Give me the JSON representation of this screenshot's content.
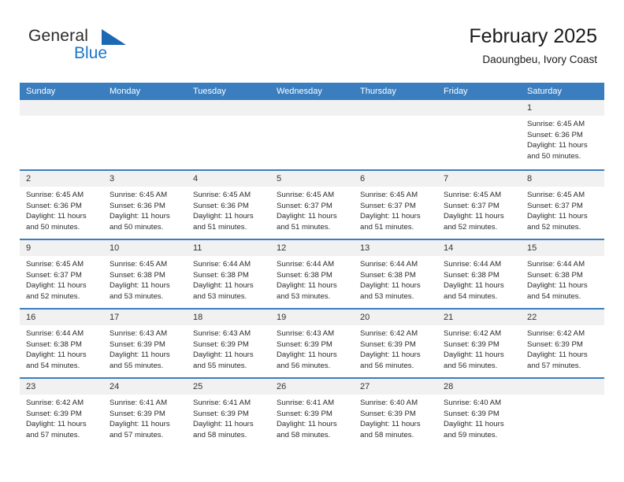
{
  "brand": {
    "name_top": "General",
    "name_bottom": "Blue",
    "accent_color": "#1c76c8",
    "triangle_color": "#1c69b3"
  },
  "header": {
    "title": "February 2025",
    "subtitle": "Daoungbeu, Ivory Coast"
  },
  "theme": {
    "header_blue": "#3a7ebf",
    "day_band_gray": "#f1f1f1",
    "text": "#2b2b2b"
  },
  "weekdays": [
    "Sunday",
    "Monday",
    "Tuesday",
    "Wednesday",
    "Thursday",
    "Friday",
    "Saturday"
  ],
  "weeks": [
    [
      {
        "day": "",
        "empty": true,
        "sunrise": "",
        "sunset": "",
        "daylight1": "",
        "daylight2": ""
      },
      {
        "day": "",
        "empty": true,
        "sunrise": "",
        "sunset": "",
        "daylight1": "",
        "daylight2": ""
      },
      {
        "day": "",
        "empty": true,
        "sunrise": "",
        "sunset": "",
        "daylight1": "",
        "daylight2": ""
      },
      {
        "day": "",
        "empty": true,
        "sunrise": "",
        "sunset": "",
        "daylight1": "",
        "daylight2": ""
      },
      {
        "day": "",
        "empty": true,
        "sunrise": "",
        "sunset": "",
        "daylight1": "",
        "daylight2": ""
      },
      {
        "day": "",
        "empty": true,
        "sunrise": "",
        "sunset": "",
        "daylight1": "",
        "daylight2": ""
      },
      {
        "day": "1",
        "empty": false,
        "sunrise": "Sunrise: 6:45 AM",
        "sunset": "Sunset: 6:36 PM",
        "daylight1": "Daylight: 11 hours",
        "daylight2": "and 50 minutes."
      }
    ],
    [
      {
        "day": "2",
        "empty": false,
        "sunrise": "Sunrise: 6:45 AM",
        "sunset": "Sunset: 6:36 PM",
        "daylight1": "Daylight: 11 hours",
        "daylight2": "and 50 minutes."
      },
      {
        "day": "3",
        "empty": false,
        "sunrise": "Sunrise: 6:45 AM",
        "sunset": "Sunset: 6:36 PM",
        "daylight1": "Daylight: 11 hours",
        "daylight2": "and 50 minutes."
      },
      {
        "day": "4",
        "empty": false,
        "sunrise": "Sunrise: 6:45 AM",
        "sunset": "Sunset: 6:36 PM",
        "daylight1": "Daylight: 11 hours",
        "daylight2": "and 51 minutes."
      },
      {
        "day": "5",
        "empty": false,
        "sunrise": "Sunrise: 6:45 AM",
        "sunset": "Sunset: 6:37 PM",
        "daylight1": "Daylight: 11 hours",
        "daylight2": "and 51 minutes."
      },
      {
        "day": "6",
        "empty": false,
        "sunrise": "Sunrise: 6:45 AM",
        "sunset": "Sunset: 6:37 PM",
        "daylight1": "Daylight: 11 hours",
        "daylight2": "and 51 minutes."
      },
      {
        "day": "7",
        "empty": false,
        "sunrise": "Sunrise: 6:45 AM",
        "sunset": "Sunset: 6:37 PM",
        "daylight1": "Daylight: 11 hours",
        "daylight2": "and 52 minutes."
      },
      {
        "day": "8",
        "empty": false,
        "sunrise": "Sunrise: 6:45 AM",
        "sunset": "Sunset: 6:37 PM",
        "daylight1": "Daylight: 11 hours",
        "daylight2": "and 52 minutes."
      }
    ],
    [
      {
        "day": "9",
        "empty": false,
        "sunrise": "Sunrise: 6:45 AM",
        "sunset": "Sunset: 6:37 PM",
        "daylight1": "Daylight: 11 hours",
        "daylight2": "and 52 minutes."
      },
      {
        "day": "10",
        "empty": false,
        "sunrise": "Sunrise: 6:45 AM",
        "sunset": "Sunset: 6:38 PM",
        "daylight1": "Daylight: 11 hours",
        "daylight2": "and 53 minutes."
      },
      {
        "day": "11",
        "empty": false,
        "sunrise": "Sunrise: 6:44 AM",
        "sunset": "Sunset: 6:38 PM",
        "daylight1": "Daylight: 11 hours",
        "daylight2": "and 53 minutes."
      },
      {
        "day": "12",
        "empty": false,
        "sunrise": "Sunrise: 6:44 AM",
        "sunset": "Sunset: 6:38 PM",
        "daylight1": "Daylight: 11 hours",
        "daylight2": "and 53 minutes."
      },
      {
        "day": "13",
        "empty": false,
        "sunrise": "Sunrise: 6:44 AM",
        "sunset": "Sunset: 6:38 PM",
        "daylight1": "Daylight: 11 hours",
        "daylight2": "and 53 minutes."
      },
      {
        "day": "14",
        "empty": false,
        "sunrise": "Sunrise: 6:44 AM",
        "sunset": "Sunset: 6:38 PM",
        "daylight1": "Daylight: 11 hours",
        "daylight2": "and 54 minutes."
      },
      {
        "day": "15",
        "empty": false,
        "sunrise": "Sunrise: 6:44 AM",
        "sunset": "Sunset: 6:38 PM",
        "daylight1": "Daylight: 11 hours",
        "daylight2": "and 54 minutes."
      }
    ],
    [
      {
        "day": "16",
        "empty": false,
        "sunrise": "Sunrise: 6:44 AM",
        "sunset": "Sunset: 6:38 PM",
        "daylight1": "Daylight: 11 hours",
        "daylight2": "and 54 minutes."
      },
      {
        "day": "17",
        "empty": false,
        "sunrise": "Sunrise: 6:43 AM",
        "sunset": "Sunset: 6:39 PM",
        "daylight1": "Daylight: 11 hours",
        "daylight2": "and 55 minutes."
      },
      {
        "day": "18",
        "empty": false,
        "sunrise": "Sunrise: 6:43 AM",
        "sunset": "Sunset: 6:39 PM",
        "daylight1": "Daylight: 11 hours",
        "daylight2": "and 55 minutes."
      },
      {
        "day": "19",
        "empty": false,
        "sunrise": "Sunrise: 6:43 AM",
        "sunset": "Sunset: 6:39 PM",
        "daylight1": "Daylight: 11 hours",
        "daylight2": "and 56 minutes."
      },
      {
        "day": "20",
        "empty": false,
        "sunrise": "Sunrise: 6:42 AM",
        "sunset": "Sunset: 6:39 PM",
        "daylight1": "Daylight: 11 hours",
        "daylight2": "and 56 minutes."
      },
      {
        "day": "21",
        "empty": false,
        "sunrise": "Sunrise: 6:42 AM",
        "sunset": "Sunset: 6:39 PM",
        "daylight1": "Daylight: 11 hours",
        "daylight2": "and 56 minutes."
      },
      {
        "day": "22",
        "empty": false,
        "sunrise": "Sunrise: 6:42 AM",
        "sunset": "Sunset: 6:39 PM",
        "daylight1": "Daylight: 11 hours",
        "daylight2": "and 57 minutes."
      }
    ],
    [
      {
        "day": "23",
        "empty": false,
        "sunrise": "Sunrise: 6:42 AM",
        "sunset": "Sunset: 6:39 PM",
        "daylight1": "Daylight: 11 hours",
        "daylight2": "and 57 minutes."
      },
      {
        "day": "24",
        "empty": false,
        "sunrise": "Sunrise: 6:41 AM",
        "sunset": "Sunset: 6:39 PM",
        "daylight1": "Daylight: 11 hours",
        "daylight2": "and 57 minutes."
      },
      {
        "day": "25",
        "empty": false,
        "sunrise": "Sunrise: 6:41 AM",
        "sunset": "Sunset: 6:39 PM",
        "daylight1": "Daylight: 11 hours",
        "daylight2": "and 58 minutes."
      },
      {
        "day": "26",
        "empty": false,
        "sunrise": "Sunrise: 6:41 AM",
        "sunset": "Sunset: 6:39 PM",
        "daylight1": "Daylight: 11 hours",
        "daylight2": "and 58 minutes."
      },
      {
        "day": "27",
        "empty": false,
        "sunrise": "Sunrise: 6:40 AM",
        "sunset": "Sunset: 6:39 PM",
        "daylight1": "Daylight: 11 hours",
        "daylight2": "and 58 minutes."
      },
      {
        "day": "28",
        "empty": false,
        "sunrise": "Sunrise: 6:40 AM",
        "sunset": "Sunset: 6:39 PM",
        "daylight1": "Daylight: 11 hours",
        "daylight2": "and 59 minutes."
      },
      {
        "day": "",
        "empty": true,
        "sunrise": "",
        "sunset": "",
        "daylight1": "",
        "daylight2": ""
      }
    ]
  ]
}
